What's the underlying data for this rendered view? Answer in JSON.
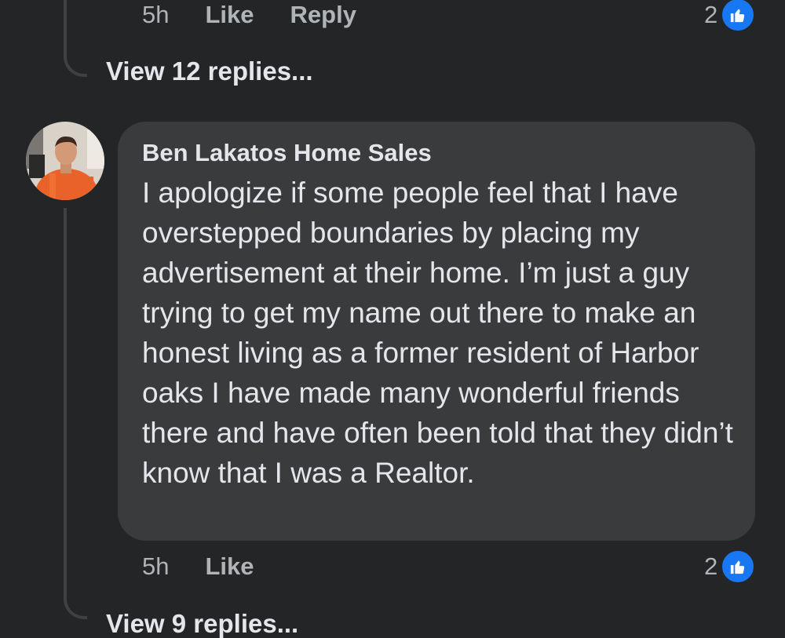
{
  "previous_comment": {
    "time": "5h",
    "like_label": "Like",
    "reply_label": "Reply",
    "reaction_count": "2",
    "view_replies": "View 12 replies..."
  },
  "comment": {
    "author": "Ben Lakatos Home Sales",
    "text": "I apologize if some people feel that I have overstepped boundaries by placing my advertisement at their home. I’m just a guy trying to get my name out there to make an honest living as a former resident of Harbor oaks I have made many wonderful friends there and have often been told that they didn’t know that I was a Realtor.",
    "time": "5h",
    "like_label": "Like",
    "reaction_count": "2",
    "view_replies": "View 9 replies..."
  },
  "colors": {
    "background": "#242526",
    "bubble": "#3a3b3c",
    "secondary_text": "#b0b3b8",
    "primary_text": "#e4e6eb",
    "like_blue": "#1877f2"
  }
}
